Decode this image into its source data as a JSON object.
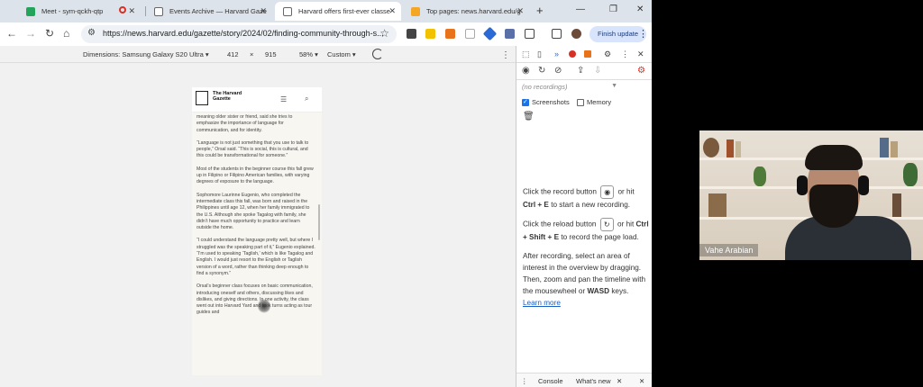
{
  "tabs": [
    {
      "title": "Meet - sym-qckh-qtp",
      "active": false
    },
    {
      "title": "Events Archive — Harvard Gaze",
      "active": false
    },
    {
      "title": "Harvard offers first-ever classe",
      "active": true
    },
    {
      "title": "Top pages: news.harvard.edu/g",
      "active": false
    }
  ],
  "toolbar": {
    "url": "https://news.harvard.edu/gazette/story/2024/02/finding-community-through-s...",
    "finish_update": "Finish update"
  },
  "devicebar": {
    "dimensions": "Dimensions: Samsung Galaxy S20 Ultra ▾",
    "width": "412",
    "times": "×",
    "height": "915",
    "zoom": "58% ▾",
    "throttle": "Custom ▾"
  },
  "phone": {
    "logo": "The Harvard Gazette",
    "paragraphs": [
      "meaning older sister or friend, said she tries to emphasize the importance of language for communication, and for identity.",
      "“Language is not just something that you use to talk to people,” Orsal said. “This is social, this is cultural, and this could be transformational for someone.”",
      "Most of the students in the beginner course this fall grew up in Filipino or Filipino American families, with varying degrees of exposure to the language.",
      "Sophomore Laurinne Eugenio, who completed the intermediate class this fall, was born and raised in the Philippines until age 12, when her family immigrated to the U.S. Although she spoke Tagalog with family, she didn’t have much opportunity to practice and learn outside the home.",
      "“I could understand the language pretty well, but where I struggled was the speaking part of it,” Eugenio explained. “I’m used to speaking ‘Taglish,’ which is like Tagalog and English. I would just resort to the English or Taglish version of a word, rather than thinking deep enough to find a synonym.”",
      "Orsal’s beginner class focuses on basic communication, introducing oneself and others, discussing likes and dislikes, and giving directions. In one activity, the class went out into Harvard Yard and took turns acting as tour guides and"
    ]
  },
  "devtools": {
    "no_recordings": "(no recordings)",
    "screenshots": "Screenshots",
    "memory": "Memory",
    "help1_a": "Click the record button",
    "help1_b": "or hit",
    "help1_key": "Ctrl + E",
    "help1_c": "to start a new recording.",
    "help2_a": "Click the reload button",
    "help2_b": "or hit",
    "help2_key": "Ctrl + Shift + E",
    "help2_c": "to record the page load.",
    "help3_a": "After recording, select an area of interest in the overview by dragging. Then, zoom and pan the timeline with the mousewheel or",
    "help3_key": "WASD",
    "help3_b": "keys.",
    "learn_more": "Learn more",
    "drawer_console": "Console",
    "drawer_whatsnew": "What's new"
  },
  "webcam": {
    "name": "Vahe Arabian"
  }
}
